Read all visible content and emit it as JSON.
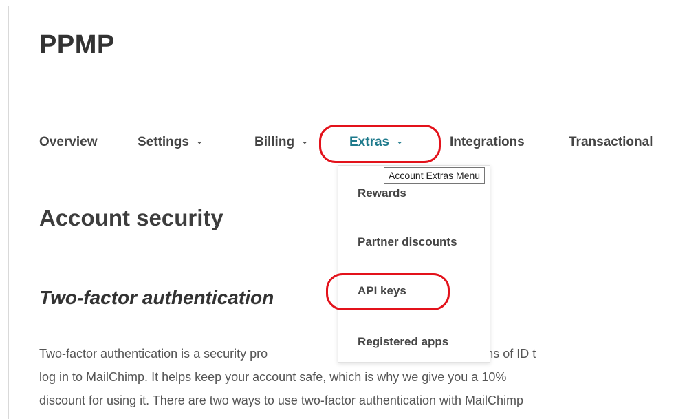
{
  "account": {
    "name": "PPMP"
  },
  "nav": {
    "items": [
      {
        "label": "Overview",
        "has_dropdown": false
      },
      {
        "label": "Settings",
        "has_dropdown": true
      },
      {
        "label": "Billing",
        "has_dropdown": true
      },
      {
        "label": "Extras",
        "has_dropdown": true,
        "active": true
      },
      {
        "label": "Integrations",
        "has_dropdown": false
      },
      {
        "label": "Transactional",
        "has_dropdown": false
      }
    ],
    "chevron": "⌄"
  },
  "extras_menu": {
    "tooltip": "Account Extras Menu",
    "items": [
      {
        "label": "Rewards"
      },
      {
        "label": "Partner discounts"
      },
      {
        "label": "API keys",
        "highlighted": true
      },
      {
        "label": "Registered apps"
      }
    ]
  },
  "main": {
    "page_title": "Account security",
    "section_title": "Two-factor authentication",
    "paragraph_lines": [
      "Two-factor authentication is a security pro",
      "provides two forms of ID t",
      "log in to MailChimp. It helps keep your account safe, which is why we give you a 10%",
      "discount for using it. There are two ways to use two-factor authentication with MailChimp"
    ]
  },
  "colors": {
    "active_nav": "#1e7a8c",
    "highlight": "#e3121b",
    "text": "#3a3a3a"
  }
}
